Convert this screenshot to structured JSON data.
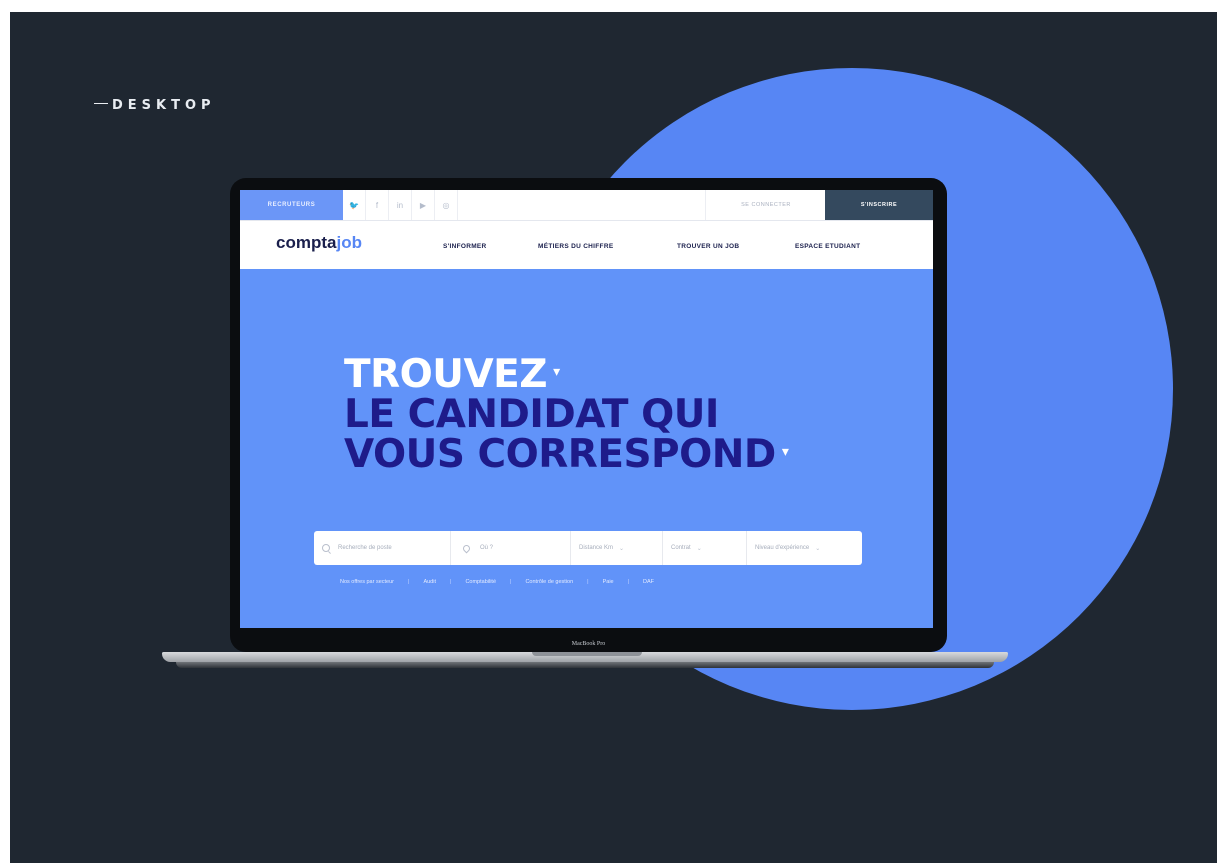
{
  "page": {
    "section_label": "DESKTOP"
  },
  "device": {
    "caption": "MacBook Pro"
  },
  "topbar": {
    "recruiters": "RECRUTEURS",
    "social_icons": [
      "twitter-icon",
      "facebook-icon",
      "linkedin-icon",
      "youtube-icon",
      "instagram-icon"
    ],
    "social_glyphs": [
      "🐦",
      "f",
      "in",
      "▶",
      "◎"
    ],
    "connect": "SE CONNECTER",
    "signup": "S'INSCRIRE"
  },
  "nav": {
    "logo_main": "compta",
    "logo_accent": "job",
    "items": [
      "S'INFORMER",
      "MÉTIERS DU CHIFFRE",
      "TROUVER UN JOB",
      "ESPACE ETUDIANT"
    ]
  },
  "hero": {
    "line1": "TROUVEZ",
    "line2": "LE CANDIDAT QUI",
    "line3": "VOUS CORRESPOND",
    "chevron": "▾"
  },
  "search": {
    "job_placeholder": "Recherche de poste",
    "location_placeholder": "Où ?",
    "distance": "Distance Km",
    "contract": "Contrat",
    "experience": "Niveau d'expérience",
    "arrow": "⌄"
  },
  "sectors": {
    "label": "Nos offres par secteur",
    "items": [
      "Audit",
      "Comptabilité",
      "Contrôle de gestion",
      "Paie",
      "DAF"
    ],
    "separator": "|"
  },
  "colors": {
    "background": "#1f2731",
    "circle": "#5786f4",
    "hero_bg": "#6193f9",
    "navy": "#1e1b8a",
    "signup_bg": "#34495e"
  }
}
